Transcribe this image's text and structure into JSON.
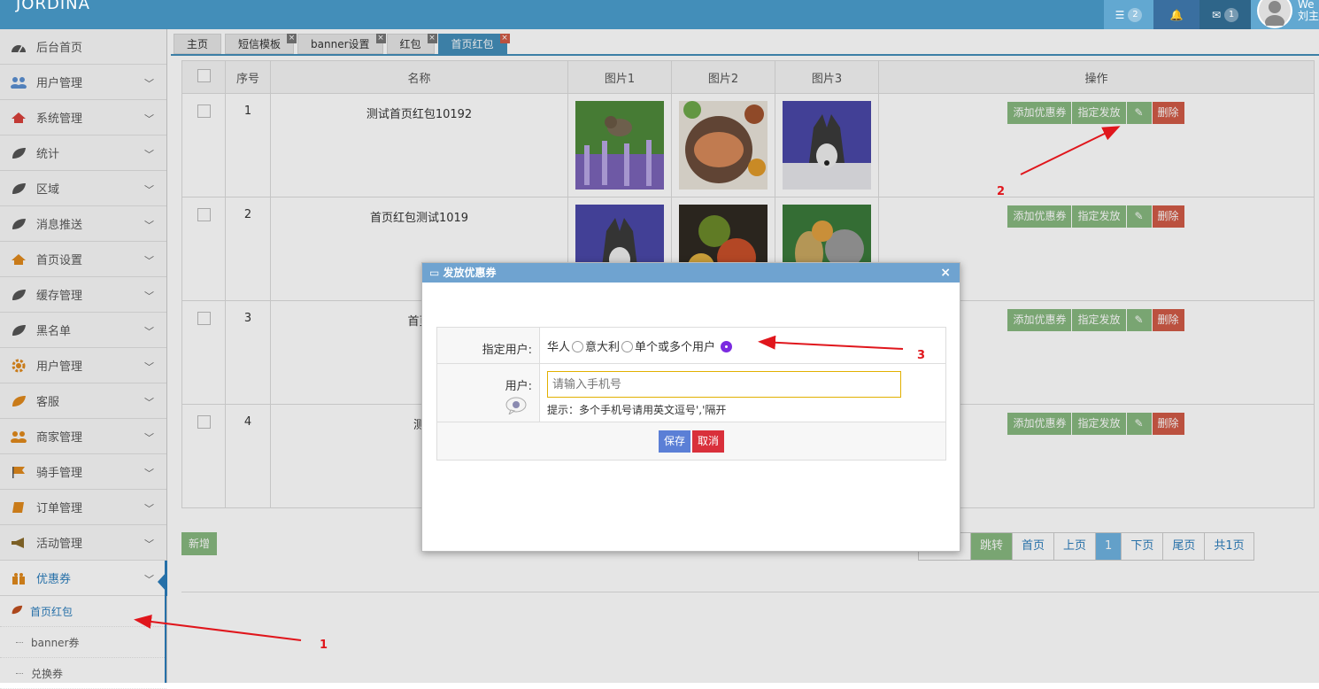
{
  "navbar": {
    "brand": "JORDINA",
    "tasks_count": "2",
    "mail_count": "1",
    "user_line1": "We",
    "user_line2": "刘主"
  },
  "sidebar": {
    "items": [
      {
        "label": "后台首页",
        "icon": "dashboard-icon"
      },
      {
        "label": "用户管理",
        "icon": "users-icon"
      },
      {
        "label": "系统管理",
        "icon": "home-icon"
      },
      {
        "label": "统计",
        "icon": "leaf-icon"
      },
      {
        "label": "区域",
        "icon": "leaf-icon"
      },
      {
        "label": "消息推送",
        "icon": "leaf-icon"
      },
      {
        "label": "首页设置",
        "icon": "home-icon"
      },
      {
        "label": "缓存管理",
        "icon": "leaf-icon"
      },
      {
        "label": "黑名单",
        "icon": "leaf-icon"
      },
      {
        "label": "用户管理",
        "icon": "cog-icon"
      },
      {
        "label": "客服",
        "icon": "leaf-icon"
      },
      {
        "label": "商家管理",
        "icon": "users-icon"
      },
      {
        "label": "骑手管理",
        "icon": "flag-icon"
      },
      {
        "label": "订单管理",
        "icon": "book-icon"
      },
      {
        "label": "活动管理",
        "icon": "bullhorn-icon"
      },
      {
        "label": "优惠券",
        "icon": "gift-icon"
      }
    ],
    "sub_items": [
      "首页红包",
      "banner券",
      "兑换券"
    ]
  },
  "tabs": [
    "主页",
    "短信模板",
    "banner设置",
    "红包",
    "首页红包"
  ],
  "table": {
    "headers": [
      "序号",
      "名称",
      "图片1",
      "图片2",
      "图片3",
      "操作"
    ],
    "rows": [
      {
        "no": "1",
        "name": "测试首页红包10192"
      },
      {
        "no": "2",
        "name": "首页红包测试1019"
      },
      {
        "no": "3",
        "name": "首页"
      },
      {
        "no": "4",
        "name": "测"
      }
    ],
    "ops": {
      "add_coupon": "添加优惠券",
      "assign": "指定发放",
      "delete": "删除"
    }
  },
  "footer": {
    "add": "新增",
    "page_input": "页码",
    "jump": "跳转",
    "first": "首页",
    "prev": "上页",
    "current": "1",
    "next": "下页",
    "last": "尾页",
    "total": "共1页"
  },
  "modal": {
    "title": "发放优惠券",
    "user_type_label": "指定用户:",
    "options": [
      "华人",
      "意大利",
      "单个或多个用户"
    ],
    "user_label": "用户:",
    "phone_placeholder": "请输入手机号",
    "hint": "提示：多个手机号请用英文逗号','隔开",
    "save": "保存",
    "cancel": "取消"
  },
  "annotations": [
    "1",
    "2",
    "3"
  ],
  "colors": {
    "navbar": "#438eb9",
    "accent": "#2b7dbc",
    "green": "#87b87f",
    "red": "#d15b47",
    "annotation": "#e0161c"
  }
}
